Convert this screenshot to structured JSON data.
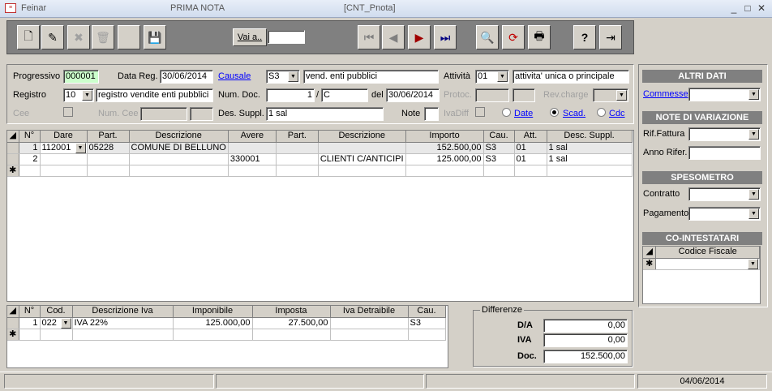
{
  "window": {
    "app": "Feinar",
    "title": "PRIMA NOTA",
    "form": "[CNT_Pnota]"
  },
  "toolbar": {
    "goto_label": "Vai a..",
    "goto_value": ""
  },
  "header": {
    "progressivo_label": "Progressivo",
    "progressivo": "000001",
    "datareg_label": "Data Reg.",
    "datareg": "30/06/2014",
    "causale_label": "Causale",
    "causale": "S3",
    "causale_desc": "vend. enti pubblici",
    "attivita_label": "Attività",
    "attivita": "01",
    "attivita_desc": "attivita' unica o principale",
    "registro_label": "Registro",
    "registro": "10",
    "registro_desc": "registro vendite enti pubblici",
    "numdoc_label": "Num. Doc.",
    "numdoc": "1",
    "numdoc_sep": "/",
    "numdoc_suffix": "C",
    "del_label": "del",
    "del": "30/06/2014",
    "protoc_label": "Protoc.",
    "revcharge_label": "Rev.charge",
    "cee_label": "Cee",
    "numcee_label": "Num. Cee",
    "dessuppl_label": "Des. Suppl.",
    "dessuppl": "1 sal",
    "note_label": "Note",
    "ivadiff_label": "IvaDiff",
    "radio_date": "Date",
    "radio_scad": "Scad.",
    "radio_cdc": "Cdc"
  },
  "grid": {
    "headers": [
      "N°",
      "Dare",
      "Part.",
      "Descrizione",
      "Avere",
      "Part.",
      "Descrizione",
      "Importo",
      "Cau.",
      "Att.",
      "Desc. Suppl."
    ],
    "rows": [
      [
        "1",
        "112001",
        "05228",
        "COMUNE DI BELLUNO",
        "",
        "",
        "",
        "152.500,00",
        "S3",
        "01",
        "1 sal"
      ],
      [
        "2",
        "",
        "",
        "",
        "330001",
        "",
        "CLIENTI C/ANTICIPI",
        "125.000,00",
        "S3",
        "01",
        "1 sal"
      ]
    ],
    "new_row_marker": "✱"
  },
  "iva": {
    "headers": [
      "N°",
      "Cod.",
      "Descrizione Iva",
      "Imponibile",
      "Imposta",
      "Iva Detraibile",
      "Cau."
    ],
    "rows": [
      [
        "1",
        "022",
        "IVA 22%",
        "125.000,00",
        "27.500,00",
        "",
        "S3"
      ]
    ]
  },
  "differenze": {
    "title": "Differenze",
    "da_label": "D/A",
    "da": "0,00",
    "iva_label": "IVA",
    "iva": "0,00",
    "doc_label": "Doc.",
    "doc": "152.500,00"
  },
  "side": {
    "altri_dati": "ALTRI DATI",
    "commesse_label": "Commesse",
    "note_variazione": "NOTE DI VARIAZIONE",
    "rif_fattura_label": "Rif.Fattura",
    "anno_rifer_label": "Anno Rifer.",
    "spesometro": "SPESOMETRO",
    "contratto_label": "Contratto",
    "pagamento_label": "Pagamento",
    "cointestatari": "CO-INTESTATARI",
    "codice_fiscale_header": "Codice Fiscale"
  },
  "status": {
    "date": "04/06/2014"
  }
}
